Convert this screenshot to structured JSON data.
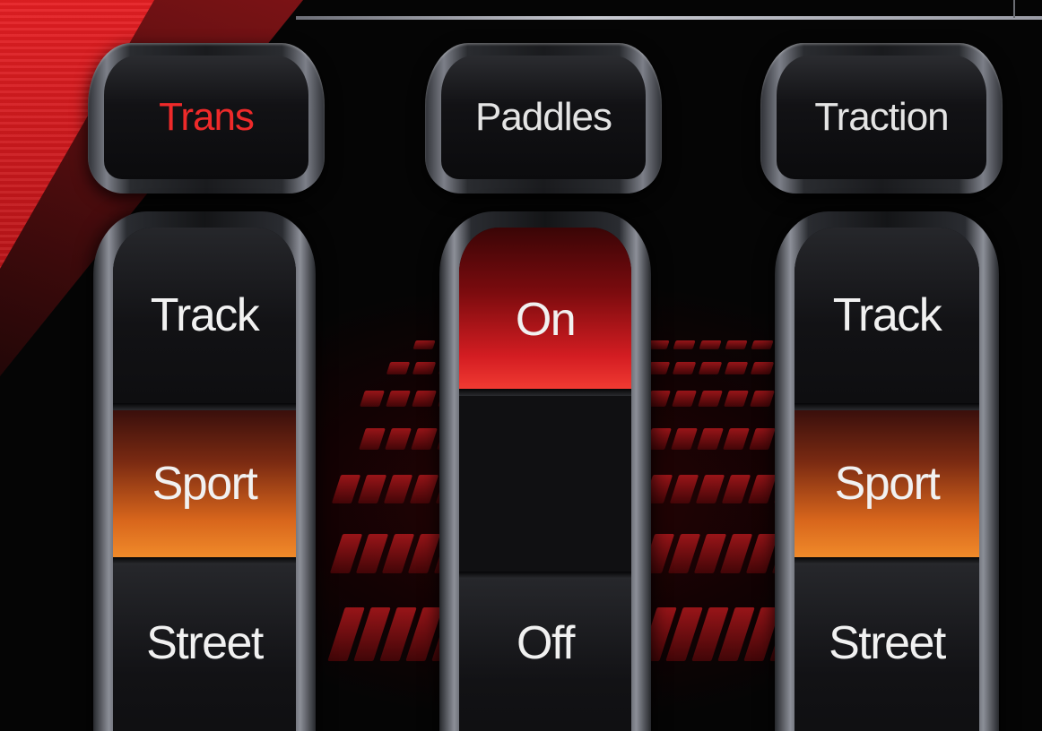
{
  "headers": [
    {
      "label": "Trans",
      "active": true
    },
    {
      "label": "Paddles",
      "active": false
    },
    {
      "label": "Traction",
      "active": false
    }
  ],
  "selectors": {
    "trans": {
      "options": [
        "Track",
        "Sport",
        "Street"
      ],
      "selected": "Sport"
    },
    "paddles": {
      "options": [
        "On",
        "Off"
      ],
      "selected": "On"
    },
    "traction": {
      "options": [
        "Track",
        "Sport",
        "Street"
      ],
      "selected": "Sport"
    }
  },
  "colors": {
    "accent_red": "#e51f23",
    "selected_orange": "#f08a2a",
    "selected_red": "#d41d22"
  }
}
